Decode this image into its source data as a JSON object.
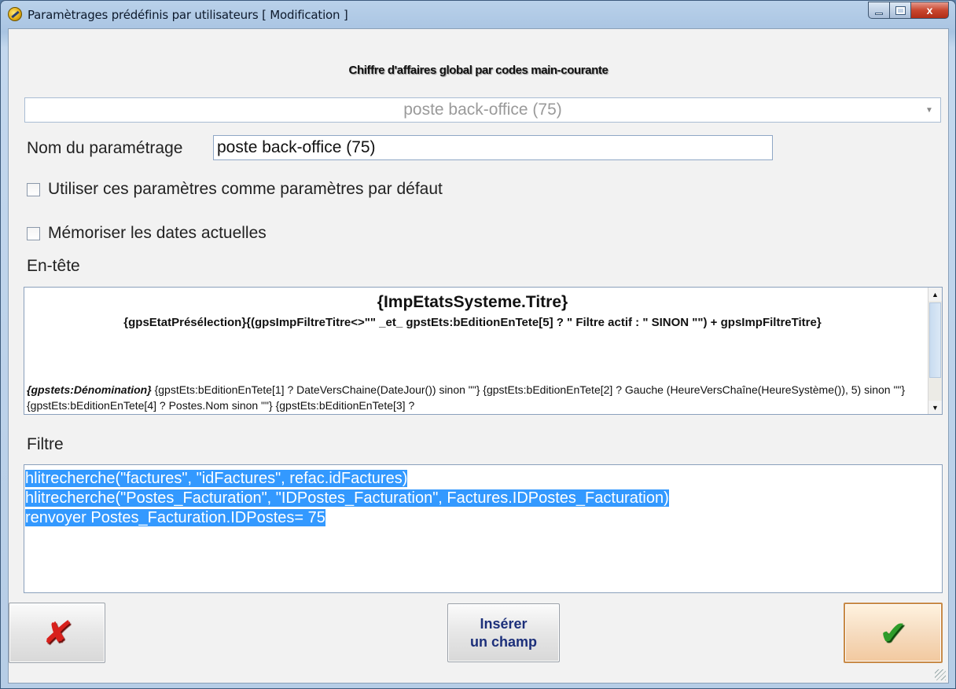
{
  "window": {
    "title": "Paramètrages prédéfinis par utilisateurs  [ Modification ]",
    "close_glyph": "x"
  },
  "subtitle": "Chiffre d'affaires global par codes main-courante",
  "preset_combo": {
    "value": "poste back-office (75)",
    "arrow": "▼"
  },
  "name_field": {
    "label": "Nom du paramétrage",
    "value": "poste back-office (75)"
  },
  "options": {
    "use_default_label": "Utiliser ces paramètres comme paramètres par défaut",
    "use_default_checked": false,
    "memorize_dates_label": "Mémoriser les dates actuelles",
    "memorize_dates_checked": false
  },
  "header_section": {
    "label": "En-tête",
    "title_line": "{ImpEtatsSysteme.Titre}",
    "sub_line": "{gpsEtatPrésélection}{(gpsImpFiltreTitre<>\"\" _et_ gpstEts:bEditionEnTete[5]  ? \" Filtre actif : \" SINON \"\") + gpsImpFiltreTitre}",
    "body_bold": "{gpstets:Dénomination}",
    "body_rest": " {gpstEts:bEditionEnTete[1] ? DateVersChaine(DateJour()) sinon \"\"} {gpstEts:bEditionEnTete[2] ? Gauche (HeureVersChaîne(HeureSystème()), 5) sinon \"\"} {gpstEts:bEditionEnTete[4] ? Postes.Nom sinon \"\"} {gpstEts:bEditionEnTete[3] ?"
  },
  "filter_section": {
    "label": "Filtre",
    "lines": [
      "hlitrecherche(\"factures\", \"idFactures\", refac.idFactures)",
      "hlitrecherche(\"Postes_Facturation\", \"IDPostes_Facturation\", Factures.IDPostes_Facturation)",
      "renvoyer Postes_Facturation.IDPostes= 75"
    ]
  },
  "buttons": {
    "cancel_glyph": "✘",
    "insert_line1": "Insérer",
    "insert_line2": "un champ",
    "ok_glyph": "✔"
  },
  "colors": {
    "selection": "#3399ff",
    "insert_text": "#1c2f7a",
    "cancel_red": "#d8201c",
    "ok_green": "#2f9c2a"
  }
}
